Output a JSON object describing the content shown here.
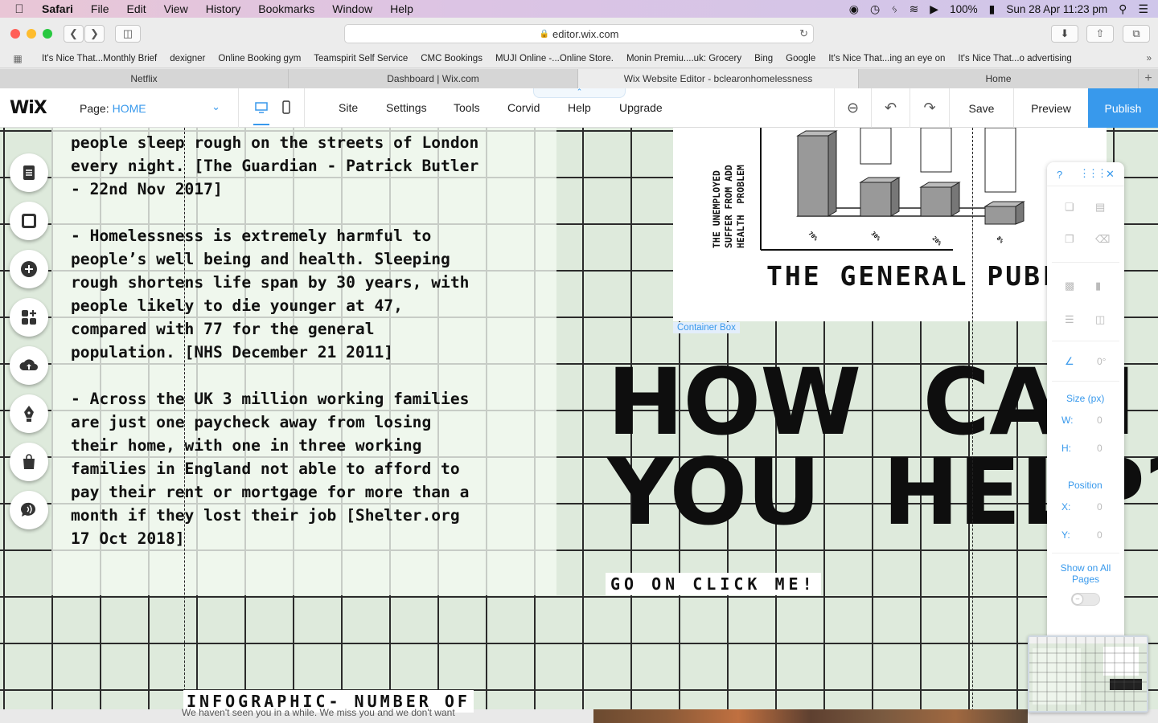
{
  "menubar": {
    "app": "Safari",
    "items": [
      "File",
      "Edit",
      "View",
      "History",
      "Bookmarks",
      "Window",
      "Help"
    ],
    "battery": "100%",
    "datetime": "Sun 28 Apr  11:23 pm"
  },
  "browser": {
    "url": "editor.wix.com",
    "bookmarks": [
      "It's Nice That...Monthly Brief",
      "dexigner",
      "Online Booking gym",
      "Teamspirit Self Service",
      "CMC Bookings",
      "MUJI Online -...Online Store.",
      "Monin Premiu....uk: Grocery",
      "Bing",
      "Google",
      "It's Nice That...ing an eye on",
      "It's Nice That...o advertising"
    ],
    "tabs": [
      {
        "title": "Netflix",
        "active": false
      },
      {
        "title": "Dashboard | Wix.com",
        "active": false
      },
      {
        "title": "Wix Website Editor - bclearonhomelessness",
        "active": true
      },
      {
        "title": "Home",
        "active": false
      }
    ]
  },
  "wix": {
    "logo": "WiX",
    "page_label": "Page:",
    "page_value": "HOME",
    "menu": [
      "Site",
      "Settings",
      "Tools",
      "Corvid",
      "Help",
      "Upgrade"
    ],
    "save": "Save",
    "preview": "Preview",
    "publish": "Publish"
  },
  "canvas": {
    "body_text": "people sleep rough on the streets of London\nevery night. [The Guardian - Patrick Butler\n- 22nd Nov 2017]\n\n- Homelessness is extremely harmful to\npeople’s well being and health. Sleeping\nrough shortens life span by 30 years, with\npeople likely to die younger at 47,\ncompared with 77 for the general\npopulation. [NHS December 21 2011]\n\n- Across the UK 3 million working families\nare just one paycheck away from losing\ntheir home, with one in three working\nfamilies in England not able to afford to\npay their rent or mortgage for more than a\nmonth if they lost their job [Shelter.org\n17 Oct 2018]",
    "chart_vertical_text": "THE UNEMPLOYED\nSUFFER FROM ADD\nHEALTH  PROBLEM",
    "chart_bar_labels": [
      "70%",
      "30%",
      "20%",
      "8%"
    ],
    "chart_caption": "THE GENERAL PUBLIC",
    "container_label": "Container Box",
    "headline": "HOW  CAN\nYOU  HELP?",
    "cta": "GO ON CLICK ME!",
    "infographic_title": "INFOGRAPHIC- NUMBER OF",
    "notice": "We haven't seen you in a while. We miss you and we don't want"
  },
  "right_panel": {
    "help": "?",
    "rotation": "0°",
    "size_label": "Size (px)",
    "w_label": "W:",
    "w_value": "0",
    "h_label": "H:",
    "h_value": "0",
    "position_label": "Position",
    "x_label": "X:",
    "x_value": "0",
    "y_label": "Y:",
    "y_value": "0",
    "show_all_pages": "Show on All Pages"
  },
  "colors": {
    "accent": "#3899ec",
    "canvas_bg": "#deeadc"
  }
}
